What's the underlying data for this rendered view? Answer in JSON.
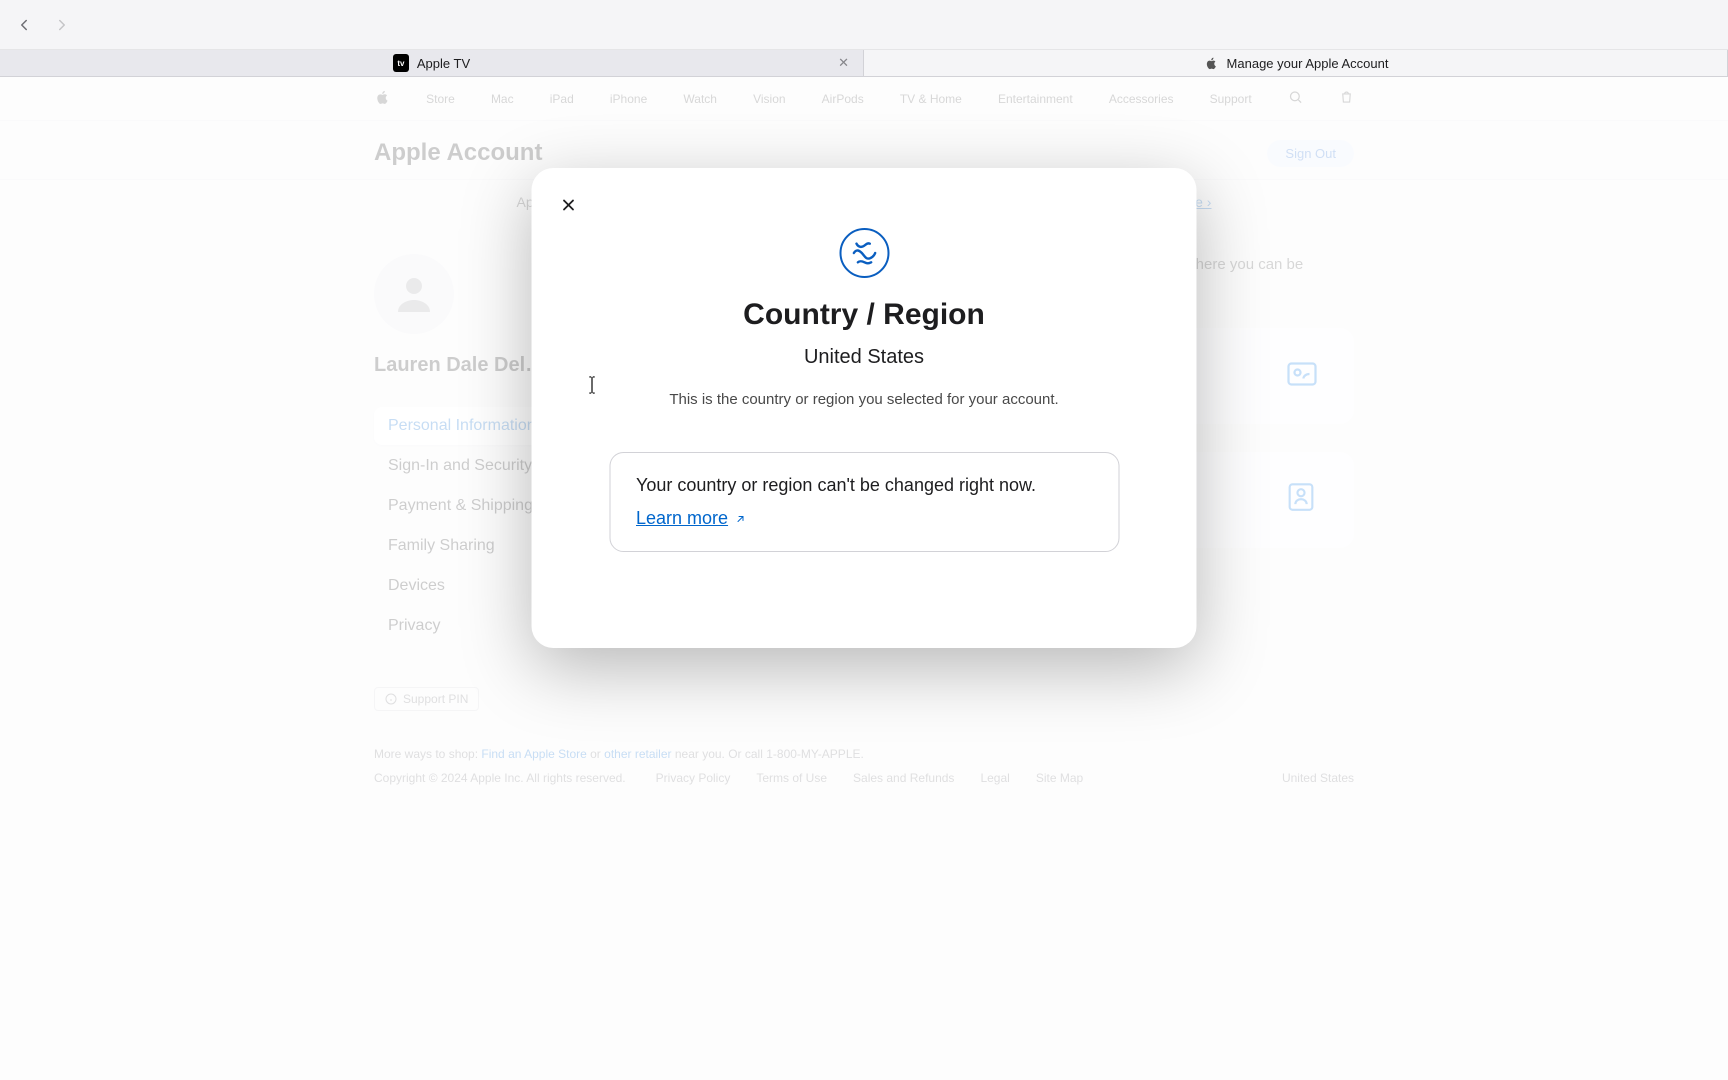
{
  "browser": {
    "tabs": [
      {
        "label": "Apple TV"
      },
      {
        "label": "Manage your Apple Account"
      }
    ]
  },
  "globalnav": {
    "items": [
      "Store",
      "Mac",
      "iPad",
      "iPhone",
      "Watch",
      "Vision",
      "AirPods",
      "TV & Home",
      "Entertainment",
      "Accessories",
      "Support"
    ]
  },
  "localnav": {
    "title": "Apple Account",
    "signout": "Sign Out"
  },
  "banner": {
    "text": "Apple ID is now Apple Account. You can still sign in with the same email address or phone number.",
    "link": "Learn more ›"
  },
  "user": {
    "name": "Lauren Dale Del…",
    "email": ""
  },
  "sidebar": {
    "items": [
      "Personal Information",
      "Sign-In and Security",
      "Payment & Shipping",
      "Family Sharing",
      "Devices",
      "Privacy"
    ]
  },
  "hint": "Manage your personal information, including email addresses and phone number where you can be reached.",
  "modal": {
    "title": "Country / Region",
    "current": "United States",
    "desc": "This is the country or region you selected for your account.",
    "info": "Your country or region can't be changed right now.",
    "learn": "Learn more"
  },
  "footer": {
    "support_pin": "Support PIN",
    "shop_line_pre": "More ways to shop: ",
    "shop_link1": "Find an Apple Store",
    "shop_mid": " or ",
    "shop_link2": "other retailer",
    "shop_suffix": " near you. Or call 1-800-MY-APPLE.",
    "copyright": "Copyright © 2024 Apple Inc. All rights reserved.",
    "legal": [
      "Privacy Policy",
      "Terms of Use",
      "Sales and Refunds",
      "Legal",
      "Site Map"
    ],
    "country": "United States"
  }
}
